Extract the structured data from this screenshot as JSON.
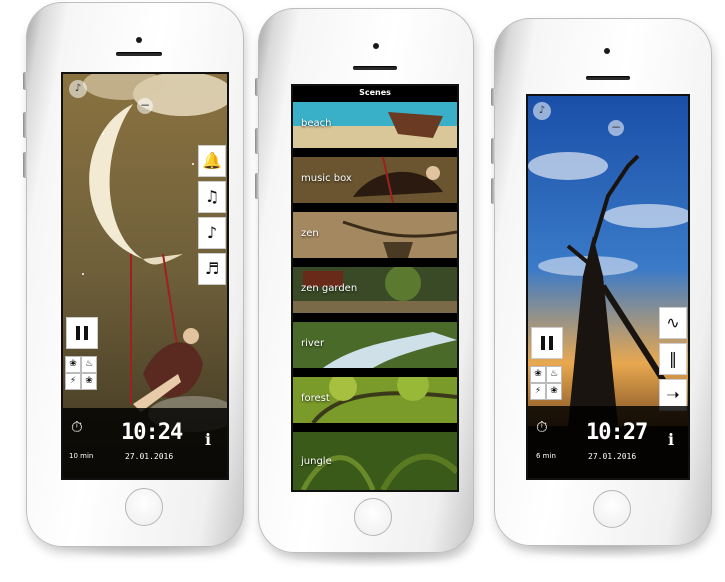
{
  "phones": [
    {
      "clock": "10:24",
      "date": "27.01.2016",
      "timer": "10 min",
      "side_icons": [
        "bell-icon",
        "guitar-stand-icon",
        "guitar-icon",
        "piano-icon"
      ]
    },
    {
      "header_title": "Scenes",
      "scenes": [
        "beach",
        "music box",
        "zen",
        "zen garden",
        "river",
        "forest",
        "jungle"
      ]
    },
    {
      "clock": "10:27",
      "date": "27.01.2016",
      "timer": "6 min",
      "side_icons": [
        "snake-icon",
        "chimes-icon",
        "flute-icon"
      ]
    }
  ],
  "icons": {
    "volume": "speaker-icon",
    "collapse": "minus-icon",
    "pause": "pause-icon",
    "timer": "timer-icon",
    "info": "i"
  }
}
